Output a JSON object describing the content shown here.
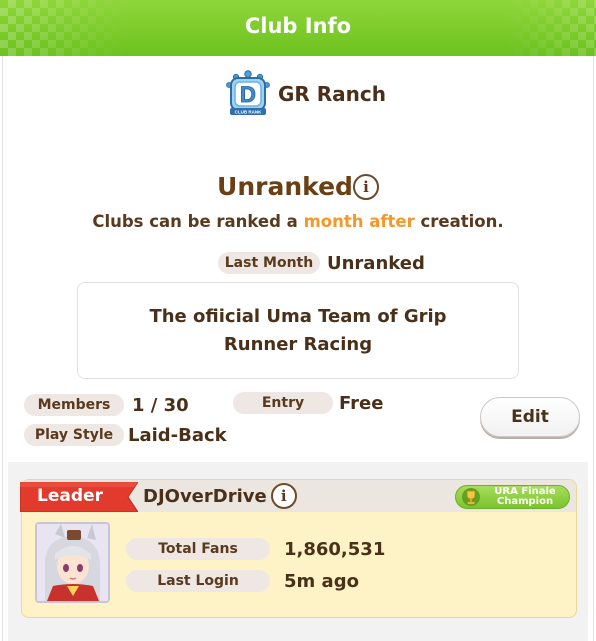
{
  "header": {
    "title": "Club Info"
  },
  "club": {
    "name": "GR Ranch",
    "emblem_icon": "club-rank-d-emblem",
    "emblem_letter": "D",
    "emblem_banner": "CLUB RANK"
  },
  "rank": {
    "status": "Unranked",
    "note_before": "Clubs can be ranked a ",
    "note_accent": "month after",
    "note_after": " creation.",
    "accent_color": "#f4982a",
    "last_month_label": "Last Month",
    "last_month_value": "Unranked"
  },
  "description": "The ofiicial Uma Team of Grip Runner Racing",
  "stats": {
    "members_label": "Members",
    "members_value": "1 / 30",
    "entry_label": "Entry",
    "entry_value": "Free",
    "play_style_label": "Play Style",
    "play_style_value": "Laid-Back"
  },
  "edit_button": {
    "label": "Edit"
  },
  "member": {
    "role": "Leader",
    "name": "DJOverDrive",
    "badge_line1": "URA Finale",
    "badge_line2": "Champion",
    "total_fans_label": "Total Fans",
    "total_fans_value": "1,860,531",
    "last_login_label": "Last Login",
    "last_login_value": "5m ago"
  },
  "colors": {
    "header_green": "#7dcc2a",
    "leader_red": "#e23b2e",
    "card_yellow": "#fdf3c6",
    "text_brown": "#5a3a1e"
  }
}
